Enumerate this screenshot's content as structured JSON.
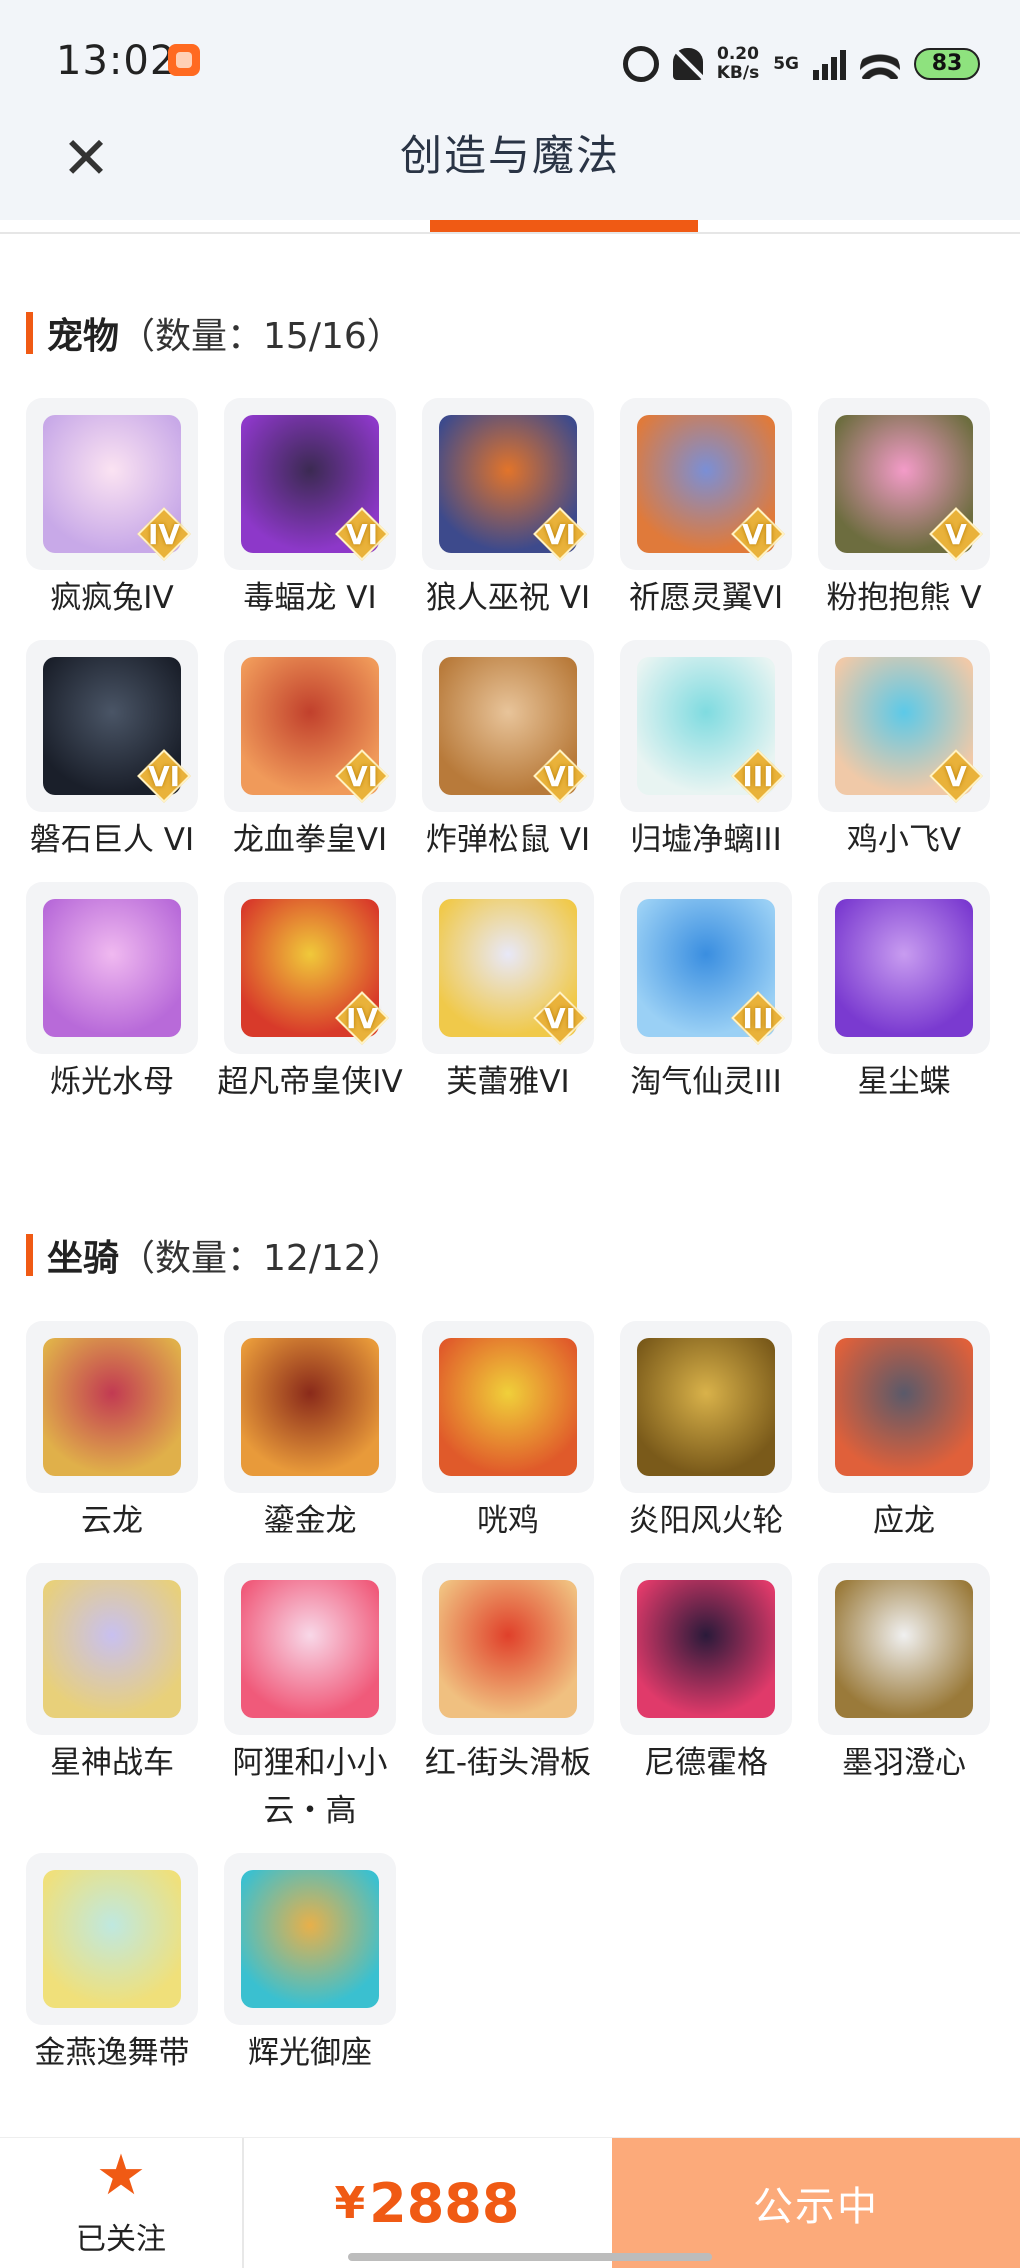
{
  "status_bar": {
    "time": "13:02",
    "speed_value": "0.20",
    "speed_unit": "KB/s",
    "network": "5G",
    "battery": "83"
  },
  "header": {
    "title": "创造与魔法"
  },
  "pets_section": {
    "name": "宠物",
    "count": "（数量：15/16）",
    "items": [
      {
        "label": "疯疯兔IV",
        "rank": "IV",
        "icon": "rabbit-pet-icon",
        "colors": [
          "#fbe3f2",
          "#c8a9e8"
        ]
      },
      {
        "label": "毒蝠龙 VI",
        "rank": "VI",
        "icon": "bat-dragon-pet-icon",
        "colors": [
          "#3b2a52",
          "#8d38c9"
        ]
      },
      {
        "label": "狼人巫祝 VI",
        "rank": "VI",
        "icon": "werewolf-pet-icon",
        "colors": [
          "#e2742a",
          "#3d4a8c"
        ]
      },
      {
        "label": "祈愿灵翼VI",
        "rank": "VI",
        "icon": "spirit-wing-pet-icon",
        "colors": [
          "#7a8fd6",
          "#e07a3a"
        ]
      },
      {
        "label": "粉抱抱熊 V",
        "rank": "V",
        "icon": "pink-bear-pet-icon",
        "colors": [
          "#f39bc8",
          "#6d6d3f"
        ]
      },
      {
        "label": "磐石巨人 VI",
        "rank": "VI",
        "icon": "rock-giant-pet-icon",
        "colors": [
          "#4a5566",
          "#1a1f2a"
        ]
      },
      {
        "label": "龙血拳皇VI",
        "rank": "VI",
        "icon": "dragon-fist-pet-icon",
        "colors": [
          "#c1402c",
          "#f09a5a"
        ]
      },
      {
        "label": "炸弹松鼠 VI",
        "rank": "VI",
        "icon": "bomb-squirrel-pet-icon",
        "colors": [
          "#e8c49a",
          "#b87a3a"
        ]
      },
      {
        "label": "归墟净螭III",
        "rank": "III",
        "icon": "sea-dragon-pet-icon",
        "colors": [
          "#7fdbe0",
          "#e8f4f2"
        ]
      },
      {
        "label": "鸡小飞V",
        "rank": "V",
        "icon": "chick-pet-icon",
        "colors": [
          "#5cc9e8",
          "#f0c9a8"
        ]
      },
      {
        "label": "烁光水母",
        "rank": "",
        "icon": "jellyfish-pet-icon",
        "colors": [
          "#f0b9f0",
          "#b86ad9"
        ]
      },
      {
        "label": "超凡帝皇侠IV",
        "rank": "IV",
        "icon": "emperor-knight-pet-icon",
        "colors": [
          "#f0c93a",
          "#d83a2a"
        ]
      },
      {
        "label": "芙蕾雅VI",
        "rank": "VI",
        "icon": "freya-pet-icon",
        "colors": [
          "#e8e8f8",
          "#f0c94a"
        ]
      },
      {
        "label": "淘气仙灵III",
        "rank": "III",
        "icon": "blue-fairy-pet-icon",
        "colors": [
          "#3a8ee0",
          "#9ad0f5"
        ]
      },
      {
        "label": "星尘蝶",
        "rank": "",
        "icon": "stardust-butterfly-pet-icon",
        "colors": [
          "#c89cf0",
          "#7a3ad0"
        ]
      }
    ]
  },
  "mounts_section": {
    "name": "坐骑",
    "count": "（数量：12/12）",
    "items": [
      {
        "label": "云龙",
        "icon": "cloud-dragon-mount-icon",
        "colors": [
          "#c23a52",
          "#e0b04a"
        ]
      },
      {
        "label": "鎏金龙",
        "icon": "gilded-dragon-mount-icon",
        "colors": [
          "#8a2a1a",
          "#e89a3a"
        ]
      },
      {
        "label": "咣鸡",
        "icon": "rooster-mount-icon",
        "colors": [
          "#f0d03a",
          "#e05a2a"
        ]
      },
      {
        "label": "炎阳风火轮",
        "icon": "fire-wheel-mount-icon",
        "colors": [
          "#d9b24a",
          "#7a5a1a"
        ]
      },
      {
        "label": "应龙",
        "icon": "ying-dragon-mount-icon",
        "colors": [
          "#5a5a6a",
          "#e0603a"
        ]
      },
      {
        "label": "星神战车",
        "icon": "star-chariot-mount-icon",
        "colors": [
          "#c8c0f0",
          "#e8d07a"
        ]
      },
      {
        "label": "阿狸和小小云・高",
        "icon": "ali-cloud-mount-icon",
        "colors": [
          "#f8d8e8",
          "#f05a7a"
        ]
      },
      {
        "label": "红-街头滑板",
        "icon": "skateboard-mount-icon",
        "colors": [
          "#e0402a",
          "#f0c080"
        ]
      },
      {
        "label": "尼德霍格",
        "icon": "nidhogg-mount-icon",
        "colors": [
          "#2a1a3a",
          "#e03a6a"
        ]
      },
      {
        "label": "墨羽澄心",
        "icon": "ink-feather-mount-icon",
        "colors": [
          "#f0f0f0",
          "#9a7a3a"
        ]
      },
      {
        "label": "金燕逸舞带",
        "icon": "golden-swallow-ribbon-mount-icon",
        "colors": [
          "#bfe8e0",
          "#f0e07a"
        ]
      },
      {
        "label": "辉光御座",
        "icon": "radiant-throne-mount-icon",
        "colors": [
          "#e8b04a",
          "#3ac0d0"
        ]
      }
    ]
  },
  "bottom_bar": {
    "follow_label": "已关注",
    "currency": "¥",
    "price": "2888",
    "status_label": "公示中"
  }
}
